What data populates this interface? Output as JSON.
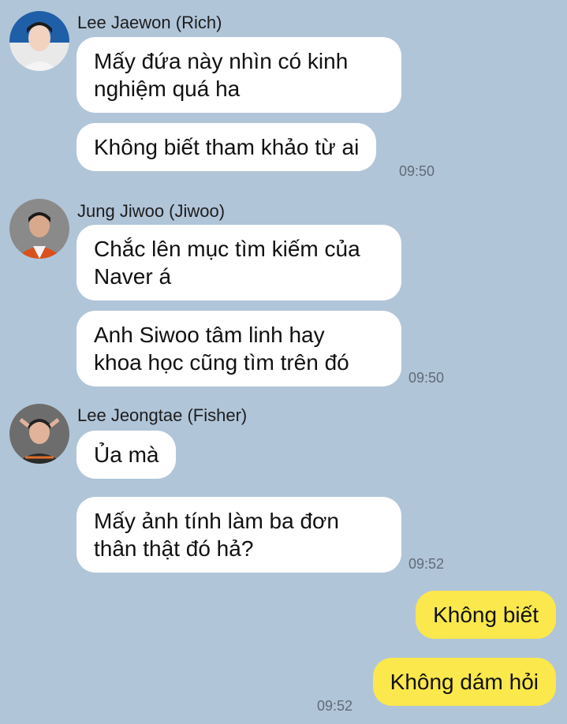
{
  "colors": {
    "background": "#b1c5d9",
    "incoming_bubble": "#ffffff",
    "outgoing_bubble": "#fbe84c",
    "timestamp": "#5f6b78"
  },
  "groups": [
    {
      "sender": "Lee Jaewon (Rich)",
      "avatar_icon": "user-avatar-icon",
      "messages": [
        "Mấy đứa này nhìn có kinh\nnghiệm quá ha",
        "Không biết tham khảo từ ai"
      ],
      "time": "09:50"
    },
    {
      "sender": "Jung Jiwoo (Jiwoo)",
      "avatar_icon": "user-avatar-icon",
      "messages": [
        "Chắc lên mục tìm kiếm của\nNaver á",
        "Anh Siwoo tâm linh hay\nkhoa học cũng tìm trên đó"
      ],
      "time": "09:50"
    },
    {
      "sender": "Lee Jeongtae (Fisher)",
      "avatar_icon": "user-avatar-icon",
      "messages": [
        "Ủa mà",
        "Mấy ảnh tính làm ba đơn\nthân thật đó hả?"
      ],
      "time": "09:52"
    }
  ],
  "outgoing": {
    "messages": [
      "Không biết",
      "Không dám hỏi"
    ],
    "time": "09:52"
  }
}
